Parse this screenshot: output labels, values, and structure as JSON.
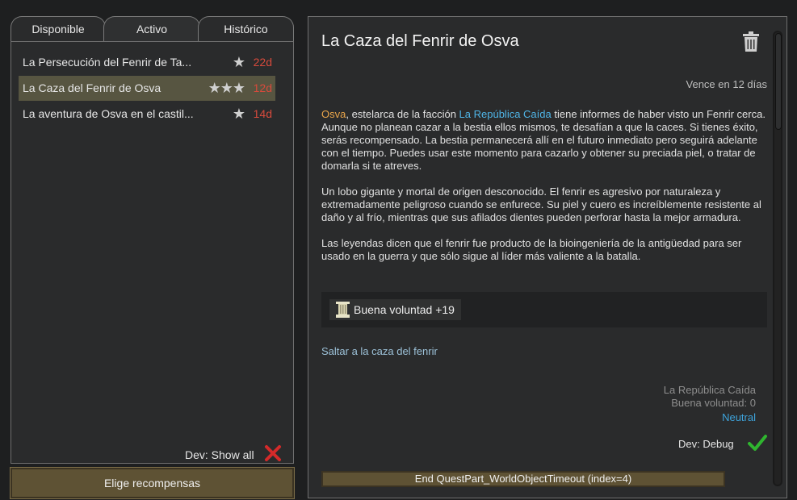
{
  "tabs": [
    {
      "label": "Disponible",
      "active": false
    },
    {
      "label": "Activo",
      "active": true
    },
    {
      "label": "Histórico",
      "active": false
    }
  ],
  "quests": [
    {
      "title": "La Persecución del Fenrir de Ta...",
      "stars": "★",
      "star_count": 1,
      "days": "22d",
      "selected": false
    },
    {
      "title": "La Caza del Fenrir de Osva",
      "stars": "★★★",
      "star_count": 3,
      "days": "12d",
      "selected": true
    },
    {
      "title": "La aventura de Osva en el castil...",
      "stars": "★",
      "star_count": 1,
      "days": "14d",
      "selected": false
    }
  ],
  "left": {
    "dev_show_all": "Dev: Show all",
    "reward_button": "Elige recompensas"
  },
  "detail": {
    "title": "La Caza del Fenrir de Osva",
    "expires": "Vence en 12 días",
    "p1_name": "Osva",
    "p1_mid": ", estelarca de la facción ",
    "p1_faction": "La República Caída",
    "p1_rest": " tiene informes de haber visto un Fenrir cerca. Aunque no planean cazar a la bestia ellos mismos, te desafían a que la caces. Si tienes éxito, serás recompensado. La bestia permanecerá allí en el futuro inmediato pero seguirá adelante con el tiempo. Puedes usar este momento para cazarlo y obtener su preciada piel, o tratar de domarla si te atreves.",
    "p2": "Un lobo gigante y mortal de origen desconocido. El fenrir es agresivo por naturaleza y extremadamente peligroso cuando se enfurece. Su piel y cuero es increíblemente resistente al daño y al frío, mientras que sus afilados dientes pueden perforar hasta la mejor armadura.",
    "p3": "Las leyendas dicen que el fenrir fue producto de la bioingeniería de la antigüedad para ser usado en la guerra y que sólo sigue al líder más valiente a la batalla.",
    "reward": "Buena voluntad +19",
    "jump_link": "Saltar a la caza del fenrir",
    "faction_name": "La República Caída",
    "faction_goodwill": "Buena voluntad: 0",
    "faction_status": "Neutral",
    "dev_debug": "Dev: Debug",
    "end_button": "End QuestPart_WorldObjectTimeout (index=4)"
  },
  "colors": {
    "days_red": "#d84a3c",
    "faction_blue": "#4fb4e6",
    "name_orange": "#e8a44a",
    "neutral_blue": "#3ea4dc",
    "selected_row": "#575541",
    "button_brown": "#5e5234",
    "check_green": "#2fb52f",
    "x_red": "#d42a2a"
  },
  "icons": {
    "delete": "trash-icon",
    "cancel": "x-icon",
    "confirm": "check-icon",
    "reward": "pillar-icon",
    "rating": "star-icon"
  }
}
